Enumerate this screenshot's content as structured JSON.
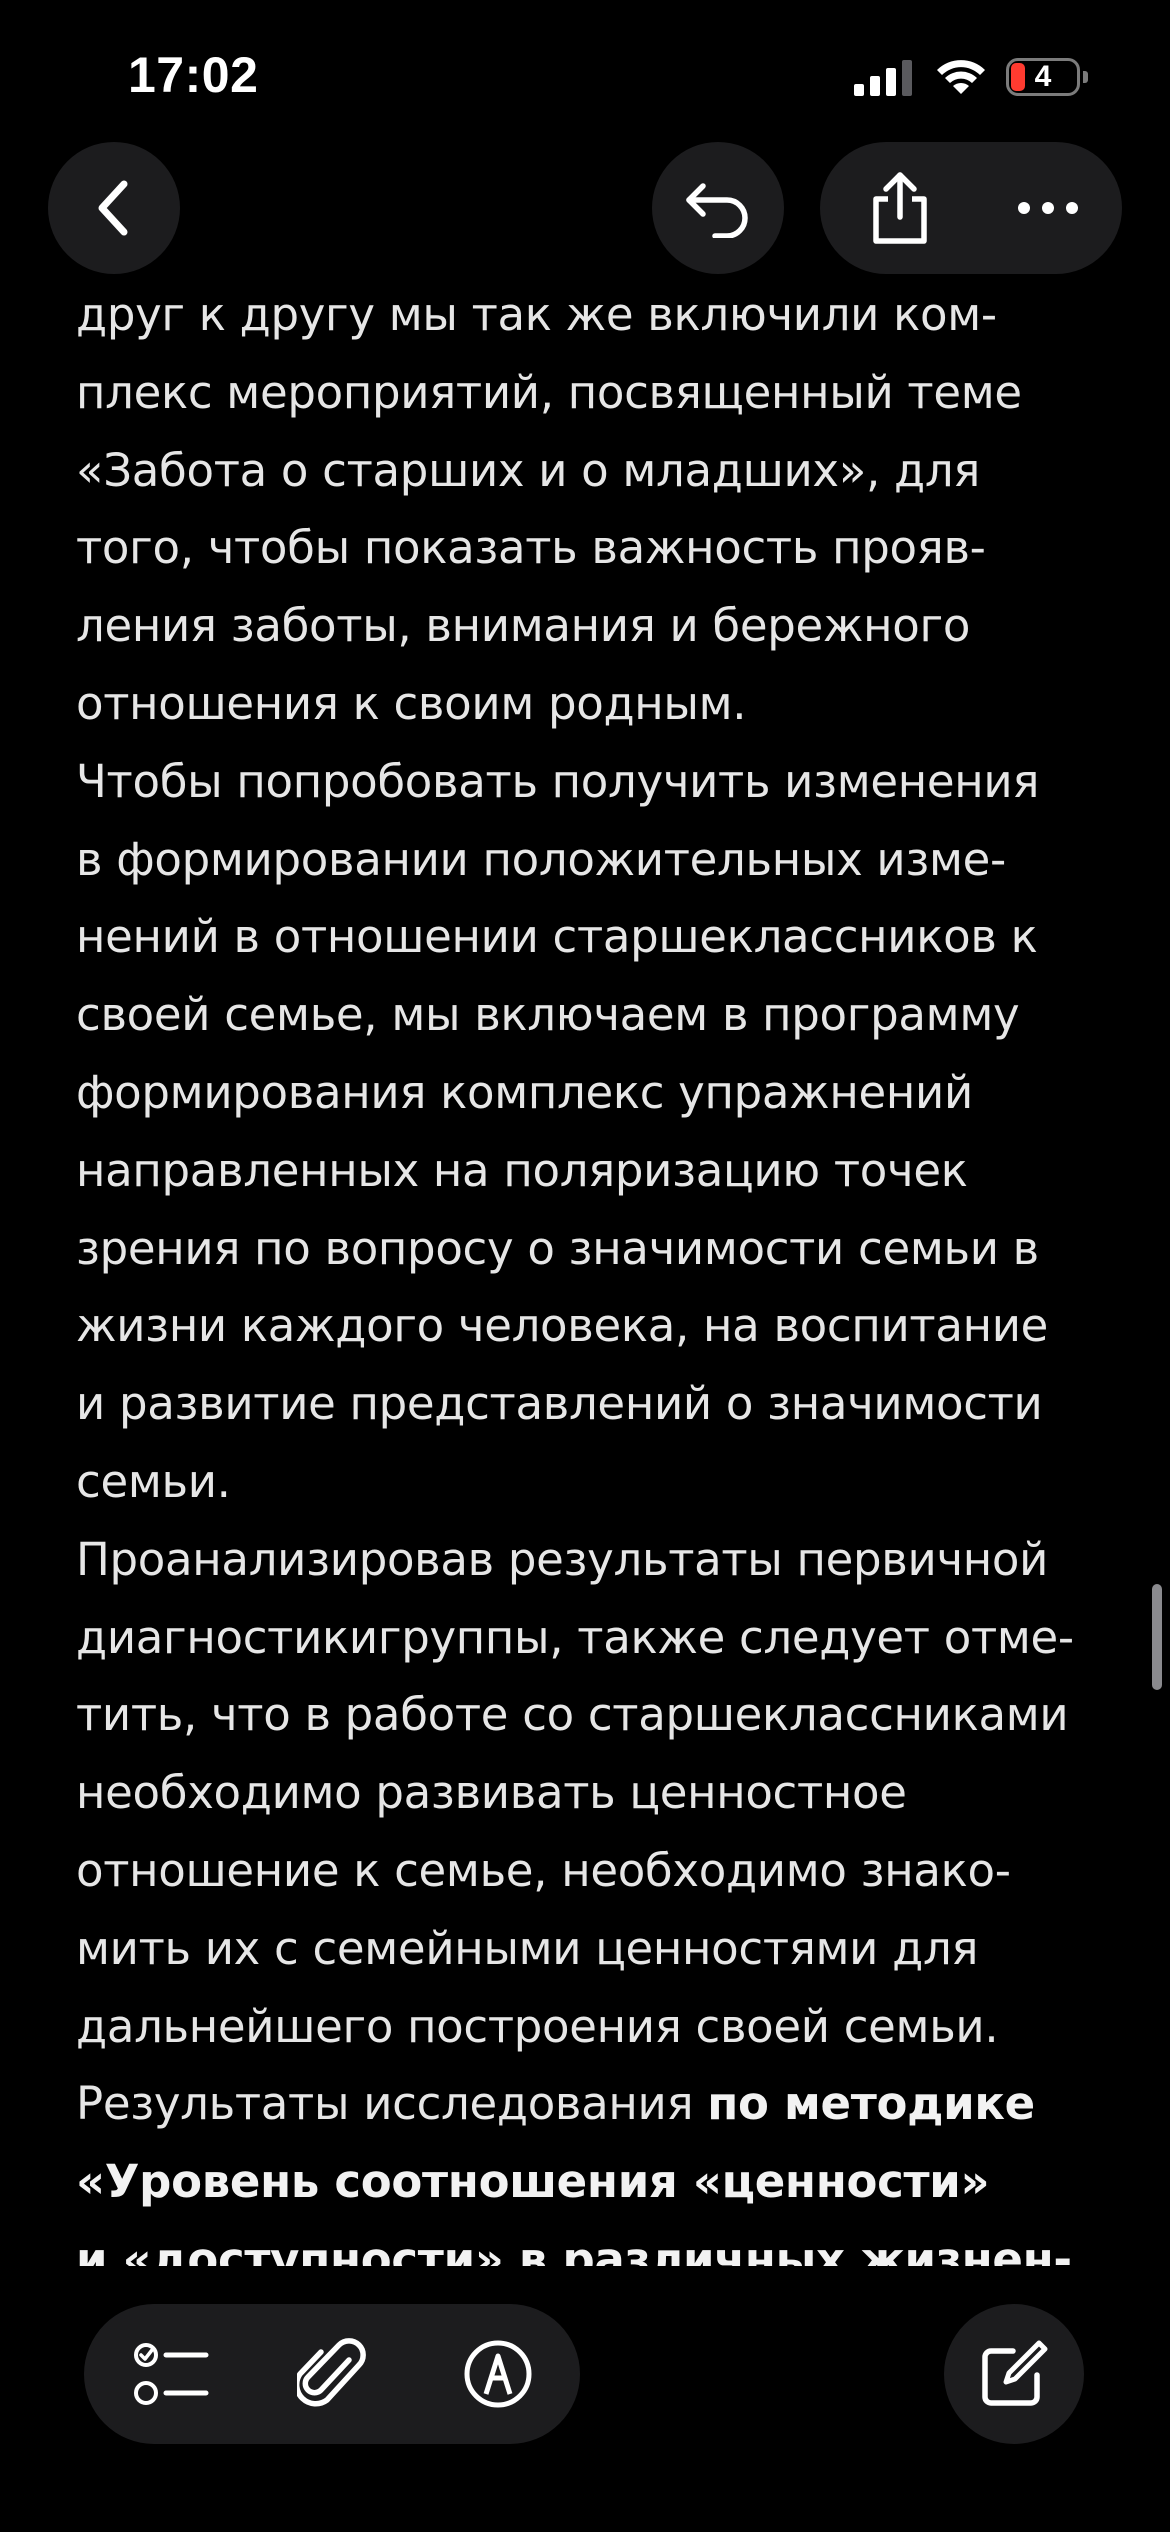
{
  "status_bar": {
    "time": "17:02",
    "battery_level": "4",
    "icons": [
      "signal-icon",
      "wifi-icon",
      "battery-icon"
    ]
  },
  "toolbar": {
    "icons": [
      "chevron-left-icon",
      "undo-icon",
      "share-icon",
      "more-icon"
    ]
  },
  "note": {
    "lines": [
      {
        "text": "друг к другу мы так же включили ком-"
      },
      {
        "text": "плекс мероприятий, посвященный теме"
      },
      {
        "text": "«Забота о старших и о младших», для"
      },
      {
        "text": "того, чтобы показать важность прояв-"
      },
      {
        "text": "ления заботы, внимания и бережного"
      },
      {
        "text": "отношения к своим родным."
      },
      {
        "text": "Чтобы попробовать получить изменения"
      },
      {
        "text": "в формировании положительных изме-"
      },
      {
        "text": "нений в отношении старшеклассников к"
      },
      {
        "text": "своей семье, мы включаем в программу"
      },
      {
        "text": "формирования комплекс упражнений"
      },
      {
        "text": "направленных на поляризацию точек"
      },
      {
        "text": "зрения по вопросу о значимости семьи в"
      },
      {
        "text": "жизни каждого человека, на воспитание"
      },
      {
        "text": "и развитие представлений о значимости"
      },
      {
        "text": "семьи."
      },
      {
        "text": "Проанализировав результаты первичной"
      },
      {
        "text": "диагностикигруппы, также следует отме-"
      },
      {
        "text": "тить, что в работе со старшеклассниками"
      },
      {
        "text": "необходимо развивать ценностное"
      },
      {
        "text": "отношение к семье, необходимо знако-"
      },
      {
        "text": "мить их с семейными ценностями для"
      },
      {
        "text": "дальнейшего построения своей семьи."
      }
    ],
    "results_line": {
      "plain": "Результаты исследования ",
      "bold": "по методике"
    },
    "bold_lines": [
      "«Уровень соотношения «ценности»",
      "и «доступности» в различных жизнен-"
    ]
  },
  "bottom_toolbar": {
    "icons": [
      "checklist-icon",
      "paperclip-icon",
      "markup-icon",
      "compose-icon"
    ]
  },
  "colors": {
    "background": "#000000",
    "button_background": "#1c1c1e",
    "text": "#e6e6e6",
    "battery_low": "#ff3b30"
  }
}
